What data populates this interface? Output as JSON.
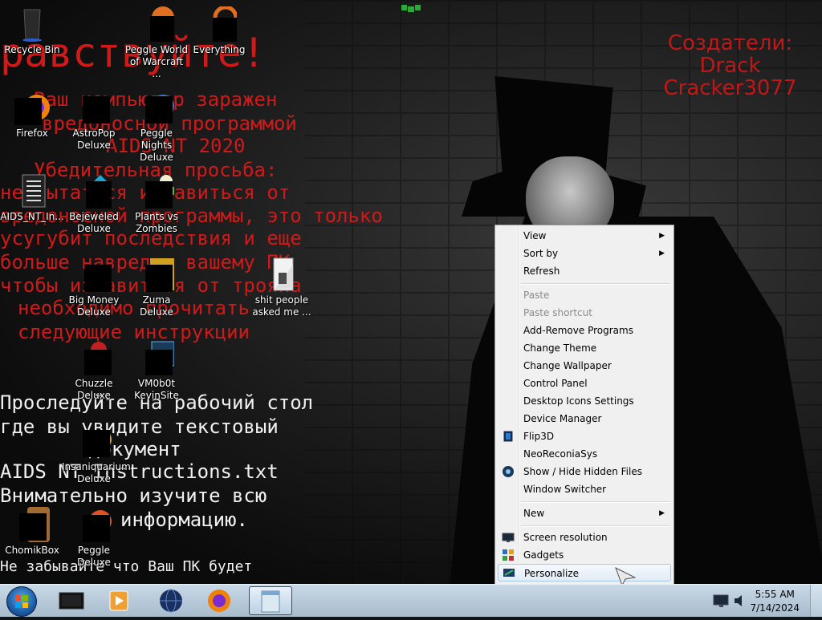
{
  "wallpaper": {
    "red_lines": [
      "равствуйте!",
      "Ваш компьютер заражен",
      "вредоносной программой",
      "AIDS NT 2020",
      "Убедительная просьба:",
      "не пытаться избавиться от",
      "вредоносной программы, это только",
      "усугубит последствия и еще",
      "больше навредит вашему ПК",
      "чтобы избавиться от трояна",
      "необходимо прочитать",
      "следующие инструкции"
    ],
    "white_lines": [
      "Проследуйте на рабочий стол",
      "где вы увидите текстовый",
      "документ",
      "AIDS NT Instructions.txt",
      "Внимательно изучите всю",
      "информацию.",
      "Не забывайте что Ваш ПК будет"
    ],
    "credits": [
      "Создатели:",
      "Drack",
      "Cracker3077"
    ]
  },
  "desktop_icons": [
    {
      "label": "Recycle Bin",
      "icon": "recycle-bin-icon"
    },
    {
      "label": "Peggle World of Warcraft ...",
      "icon": "peggle-icon"
    },
    {
      "label": "Everything",
      "icon": "search-icon"
    },
    {
      "label": "Firefox",
      "icon": "firefox-icon"
    },
    {
      "label": "AstroPop Deluxe",
      "icon": "game-icon"
    },
    {
      "label": "Peggle Nights Deluxe",
      "icon": "peggle-icon"
    },
    {
      "label": "AIDS_NT_In...",
      "icon": "text-file-icon"
    },
    {
      "label": "Bejeweled Deluxe",
      "icon": "gem-icon"
    },
    {
      "label": "Plants vs Zombies",
      "icon": "plant-icon"
    },
    {
      "label": "Big Money Deluxe",
      "icon": "game-icon"
    },
    {
      "label": "Zuma Deluxe",
      "icon": "frog-icon"
    },
    {
      "label": "shit people asked me ...",
      "icon": "folder-icon"
    },
    {
      "label": "Chuzzle Deluxe",
      "icon": "game-icon"
    },
    {
      "label": "VM0b0t KevinSite",
      "icon": "shortcut-icon"
    },
    {
      "label": "Insaniquarium Deluxe",
      "icon": "fish-icon"
    },
    {
      "label": "ChomikBox",
      "icon": "hamster-icon"
    },
    {
      "label": "Peggle Deluxe",
      "icon": "peggle-icon"
    }
  ],
  "context_menu": {
    "items": [
      {
        "label": "View"
      },
      {
        "label": "Sort by"
      },
      {
        "label": "Refresh"
      },
      {
        "label": "Paste"
      },
      {
        "label": "Paste shortcut"
      },
      {
        "label": "Add-Remove Programs"
      },
      {
        "label": "Change Theme"
      },
      {
        "label": "Change Wallpaper"
      },
      {
        "label": "Control Panel"
      },
      {
        "label": "Desktop Icons Settings"
      },
      {
        "label": "Device Manager"
      },
      {
        "label": "Flip3D"
      },
      {
        "label": "NeoReconiaSys"
      },
      {
        "label": "Show / Hide Hidden Files"
      },
      {
        "label": "Window Switcher"
      },
      {
        "label": "New"
      },
      {
        "label": "Screen resolution"
      },
      {
        "label": "Gadgets"
      },
      {
        "label": "Personalize"
      }
    ],
    "submenu_arrow": "▶"
  },
  "taskbar": {
    "clock_time": "5:55 AM",
    "clock_date": "7/14/2024",
    "pinned": [
      "terminal-icon",
      "media-player-icon",
      "globe-icon",
      "firefox-icon",
      "notepad-icon"
    ]
  },
  "colors": {
    "wallpaper_red": "#d01a1a",
    "taskbar": "#b6c8d8",
    "menu_bg": "#f0f0f0",
    "menu_hover": "#e1ecf7"
  }
}
